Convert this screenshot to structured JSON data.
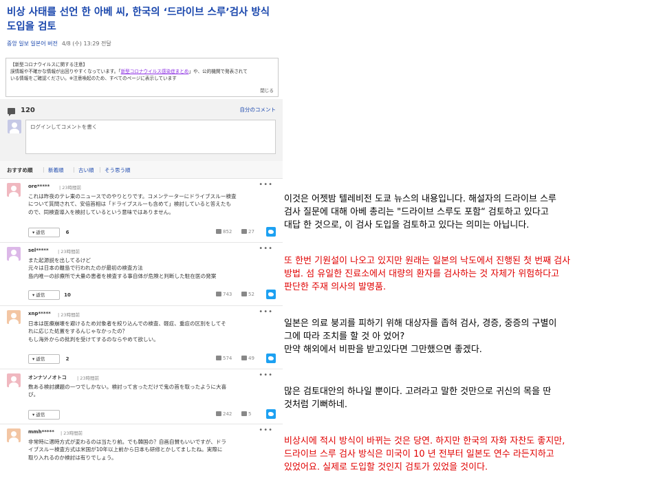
{
  "header": {
    "title": "비상 사태를 선언 한 아베 씨, 한국의 ‘드라이브 스루’검사 방식 도입을 검토",
    "source": "중앙 일보 일본어 버전",
    "date": "4/8 (수) 13:29 전달"
  },
  "notice": {
    "line1": "【新型コロナウイルスに関する注意】",
    "line2_pre": "誤情報や不確かな情報が出回りやすくなっています。「",
    "line2_link": "新型コロナウイルス感染症まとめ",
    "line2_post": "」や、公的機関で発表されて",
    "line3": "いる情報をご確認ください。※注意喚起のため、すべてのページに表示しています",
    "close": "閉じる"
  },
  "comment_bar": {
    "count": "120",
    "my_comments": "自分のコメント",
    "input_placeholder": "ログインしてコメントを書く"
  },
  "sort_tabs": [
    "おすすめ順",
    "新着順",
    "古い順",
    "そう思う順"
  ],
  "comments": [
    {
      "name": "ore*****",
      "time": "23時間前",
      "avatar_color": "#f0b8c0",
      "lines": [
        "これは昨夜のテレ東のニュースでのやりとりです。コメンテーターにドライブスルー検査",
        "について質問されて、安倍首相は「ドライブスルーも含めて」検討していると答えたも",
        "ので、同検査導入を検討しているという意味ではありません。"
      ],
      "reply_label": "返信",
      "replies": "6",
      "likes": "852",
      "dislikes": "27"
    },
    {
      "name": "sel*****",
      "time": "23時間前",
      "avatar_color": "#dcb8e8",
      "lines": [
        "また起源説を出してるけど",
        "元々は日本の離島で行われたのが最初の検査方法",
        "島内唯一の診療所で大量の患者を検査する事自体が危険と判断した駐在医の発案"
      ],
      "reply_label": "返信",
      "replies": "10",
      "likes": "743",
      "dislikes": "52"
    },
    {
      "name": "xnp*****",
      "time": "23時間前",
      "avatar_color": "#f3c6a4",
      "lines": [
        "日本は医療崩壊を避けるため対象者を絞り込んでの検査、軽症、重症の区別をしてそ",
        "れに応じた処置をするんじゃなかったの？",
        "もし海外からの批判を受けてするのならやめて欲しい。"
      ],
      "reply_label": "返信",
      "replies": "2",
      "likes": "574",
      "dislikes": "49"
    },
    {
      "name": "オンナソノオトコ",
      "time": "23時間前",
      "avatar_color": "#f0b8c0",
      "lines": [
        "数ある検討課題の一つでしかない。検討って言っただけで鬼の首を取ったように大喜",
        "び。"
      ],
      "reply_label": "返信",
      "replies": "",
      "likes": "242",
      "dislikes": "5"
    },
    {
      "name": "mmh*****",
      "time": "23時間前",
      "avatar_color": "#f3c6a4",
      "lines": [
        "非常時に適時方式が変わるのは当たり前。でも韓国の？自画自賛もいいですが、ドラ",
        "イブスルー検査方式は米国が10年以上前から日本も研修とかしてましたね。実際に",
        "取り入れるのか検討は有りでしょう。"
      ],
      "reply_label": "",
      "replies": "",
      "likes": "",
      "dislikes": ""
    }
  ],
  "translations": [
    {
      "color": "black",
      "lines": [
        "이것은 어젯밤 텔레비전 도쿄 뉴스의 내용입니다. 해설자의 드라이브 스루",
        "검사 질문에 대해 아베 총리는 \"드라이브 스루도 포함“ 검토하고 있다고",
        "대답 한 것으로, 이 검사 도입을 검토하고 있다는 의미는 아닙니다."
      ]
    },
    {
      "color": "red",
      "lines": [
        "또 한번 기원설이 나오고 있지만 원래는 일본의 낙도에서 진행된 첫 번째 검사",
        "방법. 섬 유일한 진료소에서 대량의 환자를 검사하는 것 자체가 위험하다고",
        "판단한 주재 의사의 발명품."
      ]
    },
    {
      "color": "black",
      "lines": [
        "일본은 의료 붕괴를 피하기 위해 대상자를 좁혀 검사, 경증, 중증의 구별이",
        "그에 따라 조치를 할 것 아 었어?",
        "만약 해외에서 비판을 받고있다면 그만했으면 좋겠다."
      ]
    },
    {
      "color": "black",
      "lines": [
        "많은 검토대안의 하나일 뿐이다. 고려라고 말한 것만으로 귀신의 목을 딴",
        "것처럼 기뻐하네."
      ]
    },
    {
      "color": "red",
      "lines": [
        "비상시에 적시 방식이 바뀌는 것은 당연. 하지만 한국의 자화 자찬도 좋지만,",
        "드라이브 스루 검사 방식은 미국이 10 년 전부터 일본도 연수 라든지하고",
        "있었어요. 실제로 도입할 것인지 검토가 있었을 것이다."
      ]
    }
  ]
}
